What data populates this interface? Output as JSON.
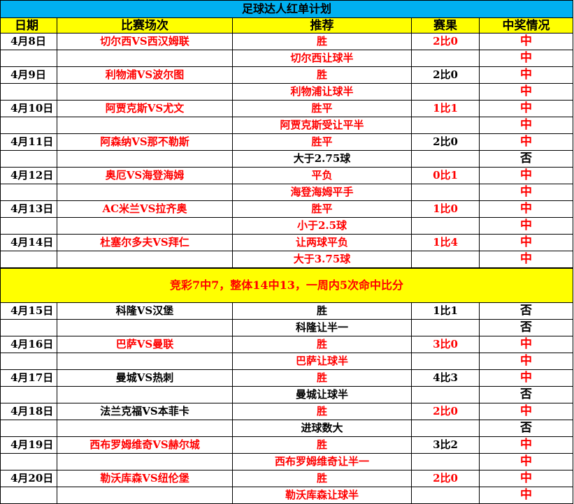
{
  "title": "足球达人红单计划",
  "headers": {
    "date": "日期",
    "match": "比赛场次",
    "tip": "推荐",
    "result": "赛果",
    "hit": "中奖情况"
  },
  "section1": [
    {
      "date": "4月8日",
      "match": "切尔西VS西汉姆联",
      "tips": [
        "胜",
        "切尔西让球半"
      ],
      "result": "2比0",
      "hits": [
        "中",
        "中"
      ]
    },
    {
      "date": "4月9日",
      "match": "利物浦VS波尔图",
      "tips": [
        "胜",
        "利物浦让球半"
      ],
      "result": "2比0",
      "hits": [
        "中",
        "中"
      ]
    },
    {
      "date": "4月10日",
      "match": "阿贾克斯VS尤文",
      "tips": [
        "胜平",
        "阿贾克斯受让平半"
      ],
      "result": "1比1",
      "hits": [
        "中",
        "中"
      ]
    },
    {
      "date": "4月11日",
      "match": "阿森纳VS那不勒斯",
      "tips": [
        "胜平",
        "大于2.75球"
      ],
      "result": "2比0",
      "hits": [
        "中",
        "否"
      ]
    },
    {
      "date": "4月12日",
      "match": "奥厄VS海登海姆",
      "tips": [
        "平负",
        "海登海姆平手"
      ],
      "result": "0比1",
      "hits": [
        "中",
        "中"
      ]
    },
    {
      "date": "4月13日",
      "match": "AC米兰VS拉齐奥",
      "tips": [
        "胜平",
        "小于2.5球"
      ],
      "result": "1比0",
      "hits": [
        "中",
        "中"
      ]
    },
    {
      "date": "4月14日",
      "match": "杜塞尔多夫VS拜仁",
      "tips": [
        "让两球平负",
        "大于3.75球"
      ],
      "result": "1比4",
      "hits": [
        "中",
        "中"
      ]
    }
  ],
  "banner": "竞彩7中7，整体14中13，一周内5次命中比分",
  "section2": [
    {
      "date": "4月15日",
      "match": "科隆VS汉堡",
      "tips": [
        "胜",
        "科隆让半一"
      ],
      "result": "1比1",
      "hits": [
        "否",
        "否"
      ]
    },
    {
      "date": "4月16日",
      "match": "巴萨VS曼联",
      "tips": [
        "胜",
        "巴萨让球半"
      ],
      "result": "3比0",
      "hits": [
        "中",
        "中"
      ]
    },
    {
      "date": "4月17日",
      "match": "曼城VS热刺",
      "tips": [
        "胜",
        "曼城让球半"
      ],
      "result": "4比3",
      "hits": [
        "中",
        "否"
      ]
    },
    {
      "date": "4月18日",
      "match": "法兰克福VS本菲卡",
      "tips": [
        "胜",
        "进球数大"
      ],
      "result": "2比0",
      "hits": [
        "中",
        "否"
      ]
    },
    {
      "date": "4月19日",
      "match": "西布罗姆维奇VS赫尔城",
      "tips": [
        "胜",
        "西布罗姆维奇让半一"
      ],
      "result": "3比2",
      "hits": [
        "中",
        "中"
      ]
    },
    {
      "date": "4月20日",
      "match": "勒沃库森VS纽伦堡",
      "tips": [
        "胜",
        "勒沃库森让球半"
      ],
      "result": "2比0",
      "hits": [
        "中",
        "中"
      ]
    }
  ],
  "colors": {
    "title_bg": "#00b0f0",
    "header_bg": "#ffff00",
    "banner_bg": "#ffff00",
    "red": "#ff0000",
    "black": "#000000"
  },
  "row_styles": {
    "section1": [
      {
        "match_red": true,
        "tip_red": [
          true,
          true
        ],
        "result_red": true,
        "hit_red": [
          true,
          true
        ]
      },
      {
        "match_red": true,
        "tip_red": [
          true,
          true
        ],
        "result_red": false,
        "hit_red": [
          true,
          true
        ]
      },
      {
        "match_red": true,
        "tip_red": [
          true,
          true
        ],
        "result_red": true,
        "hit_red": [
          true,
          true
        ]
      },
      {
        "match_red": true,
        "tip_red": [
          true,
          false
        ],
        "result_red": false,
        "hit_red": [
          true,
          false
        ]
      },
      {
        "match_red": true,
        "tip_red": [
          true,
          true
        ],
        "result_red": true,
        "hit_red": [
          true,
          true
        ]
      },
      {
        "match_red": true,
        "tip_red": [
          true,
          true
        ],
        "result_red": true,
        "hit_red": [
          true,
          true
        ]
      },
      {
        "match_red": true,
        "tip_red": [
          true,
          true
        ],
        "result_red": true,
        "hit_red": [
          true,
          true
        ]
      }
    ],
    "section2": [
      {
        "match_red": false,
        "tip_red": [
          false,
          false
        ],
        "result_red": false,
        "hit_red": [
          false,
          false
        ]
      },
      {
        "match_red": true,
        "tip_red": [
          true,
          true
        ],
        "result_red": true,
        "hit_red": [
          true,
          true
        ]
      },
      {
        "match_red": false,
        "tip_red": [
          true,
          false
        ],
        "result_red": false,
        "hit_red": [
          true,
          false
        ]
      },
      {
        "match_red": false,
        "tip_red": [
          true,
          false
        ],
        "result_red": true,
        "hit_red": [
          true,
          false
        ]
      },
      {
        "match_red": true,
        "tip_red": [
          true,
          true
        ],
        "result_red": false,
        "hit_red": [
          true,
          true
        ]
      },
      {
        "match_red": true,
        "tip_red": [
          true,
          true
        ],
        "result_red": true,
        "hit_red": [
          true,
          true
        ]
      }
    ]
  }
}
